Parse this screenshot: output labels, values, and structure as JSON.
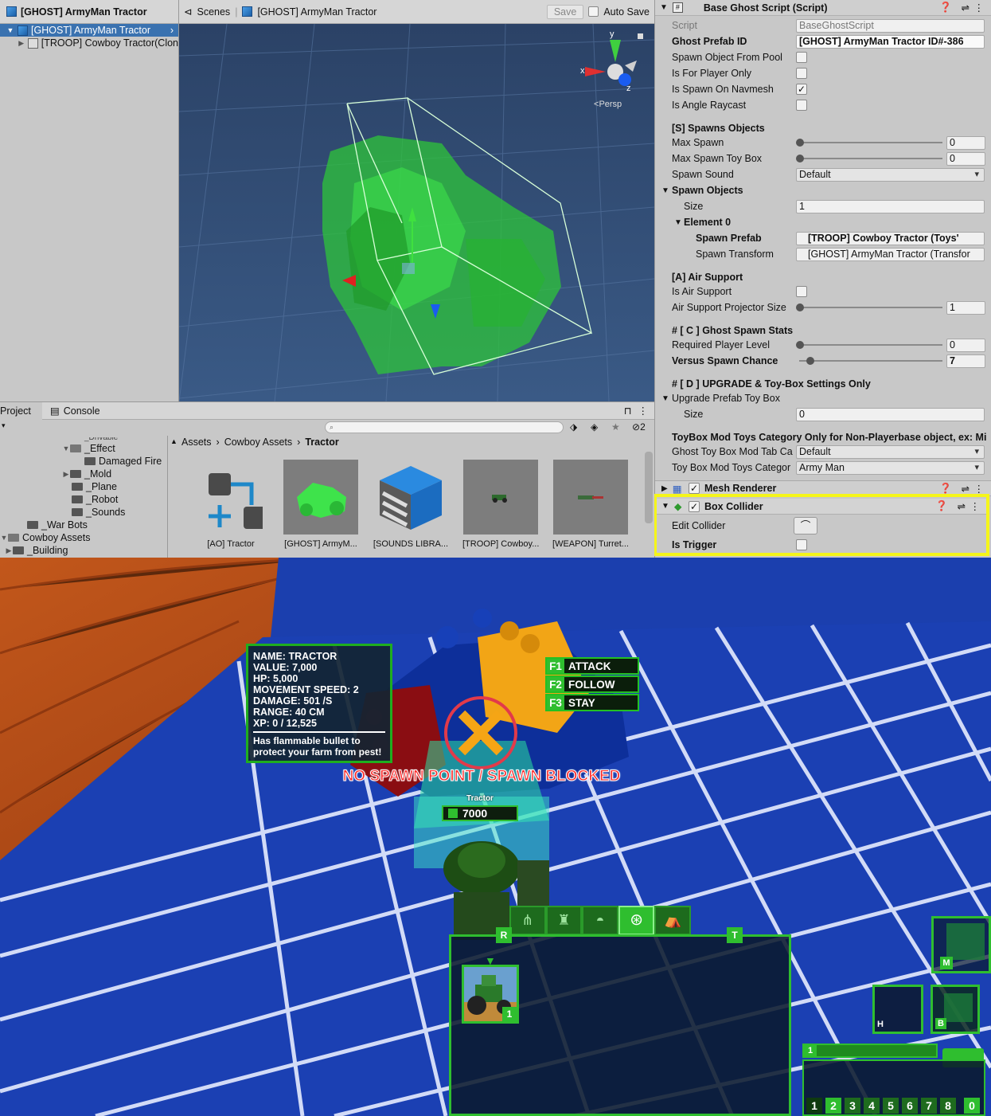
{
  "hierarchy": {
    "title": "[GHOST] ArmyMan Tractor",
    "items": [
      {
        "label": "[GHOST] ArmyMan Tractor",
        "selected": true
      },
      {
        "label": "[TROOP] Cowboy Tractor(Clon",
        "selected": false
      }
    ]
  },
  "scene": {
    "scenes_label": "Scenes",
    "title": "[GHOST] ArmyMan Tractor",
    "save_label": "Save",
    "autosave_label": "Auto Save",
    "persp_label": "Persp",
    "gizmo": {
      "x": "x",
      "y": "y",
      "z": "z"
    }
  },
  "inspector": {
    "component_title": "Base Ghost Script (Script)",
    "rows": {
      "script": {
        "label": "Script",
        "value": "BaseGhostScript"
      },
      "ghost_prefab_id": {
        "label": "Ghost Prefab ID",
        "value": "[GHOST] ArmyMan Tractor ID#-386"
      },
      "spawn_from_pool": {
        "label": "Spawn Object From Pool",
        "checked": false
      },
      "player_only": {
        "label": "Is For Player Only",
        "checked": false
      },
      "spawn_navmesh": {
        "label": "Is Spawn On Navmesh",
        "checked": true
      },
      "angle_raycast": {
        "label": "Is Angle Raycast",
        "checked": false
      },
      "section_s": "[S] Spawns Objects",
      "max_spawn": {
        "label": "Max Spawn",
        "value": "0"
      },
      "max_spawn_toybox": {
        "label": "Max Spawn Toy Box",
        "value": "0"
      },
      "spawn_sound": {
        "label": "Spawn Sound",
        "value": "Default"
      },
      "spawn_objects": "Spawn Objects",
      "size": {
        "label": "Size",
        "value": "1"
      },
      "element0": "Element 0",
      "spawn_prefab": {
        "label": "Spawn Prefab",
        "value": "[TROOP] Cowboy Tractor (Toys'"
      },
      "spawn_transform": {
        "label": "Spawn Transform",
        "value": "[GHOST] ArmyMan Tractor (Transfor"
      },
      "section_a": "[A] Air Support",
      "is_air_support": {
        "label": "Is Air Support",
        "checked": false
      },
      "air_projector": {
        "label": "Air Support Projector Size",
        "value": "1"
      },
      "section_c": "# [ C ] Ghost Spawn Stats",
      "req_level": {
        "label": "Required Player Level",
        "value": "0"
      },
      "versus_chance": {
        "label": "Versus Spawn Chance",
        "value": "7"
      },
      "section_d": "# [ D ] UPGRADE & Toy-Box Settings Only",
      "upgrade_prefab": "Upgrade Prefab Toy Box",
      "size2": {
        "label": "Size",
        "value": "0"
      },
      "toybox_note": "ToyBox Mod Toys Category Only for Non-Playerbase object, ex: Mil",
      "ghost_tab": {
        "label": "Ghost Toy Box Mod Tab Ca",
        "value": "Default"
      },
      "toy_category": {
        "label": "Toy Box Mod Toys Categor",
        "value": "Army Man"
      }
    },
    "mesh_renderer": "Mesh Renderer",
    "box_collider": "Box Collider",
    "edit_collider": "Edit Collider",
    "is_trigger": "Is Trigger",
    "highlight_color": "#f5f51a"
  },
  "project": {
    "tab_project": "Project",
    "tab_console": "Console",
    "hidden_count": "2",
    "tree": [
      "_Effect",
      "Damaged Fire",
      "_Mold",
      "_Plane",
      "_Robot",
      "_Sounds",
      "_War Bots",
      "Cowboy Assets",
      "_Building"
    ],
    "breadcrumb": [
      "Assets",
      "Cowboy Assets",
      "Tractor"
    ],
    "assets": [
      "[AO] Tractor",
      "[GHOST] ArmyM...",
      "[SOUNDS LIBRA...",
      "[TROOP] Cowboy...",
      "[WEAPON] Turret..."
    ]
  },
  "game": {
    "stats": {
      "lines": [
        "NAME: TRACTOR",
        "VALUE: 7,000",
        "HP: 5,000",
        "MOVEMENT SPEED: 2",
        "DAMAGE: 501 /S",
        "RANGE: 40 CM",
        "XP: 0 / 12,525"
      ],
      "description": "Has flammable bullet to protect your farm from pest!"
    },
    "commands": [
      {
        "key": "F1",
        "label": "ATTACK"
      },
      {
        "key": "F2",
        "label": "FOLLOW"
      },
      {
        "key": "F3",
        "label": "STAY"
      }
    ],
    "warning": "NO SPAWN POINT / SPAWN BLOCKED",
    "unit_name": "Tractor",
    "unit_cost": "7000",
    "panel_r": "R",
    "panel_t": "T",
    "card_count": "1",
    "side": {
      "m": "M",
      "h": "H",
      "b": "B",
      "bar_num": "1"
    },
    "numkeys": [
      "1",
      "2",
      "3",
      "4",
      "5",
      "6",
      "7",
      "8",
      "0"
    ]
  }
}
